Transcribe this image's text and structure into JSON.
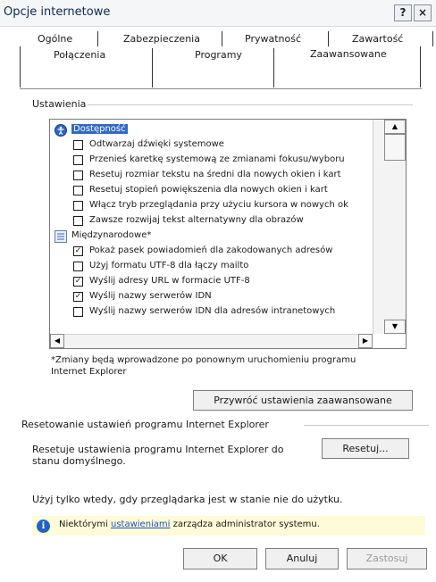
{
  "window": {
    "title": "Opcje internetowe",
    "help_glyph": "?",
    "close_glyph": "×"
  },
  "tabs": {
    "row1": [
      "Ogólne",
      "Zabezpieczenia",
      "Prywatność",
      "Zawartość"
    ],
    "row2": [
      "Połączenia",
      "Programy",
      "Zaawansowane"
    ],
    "active": "Zaawansowane"
  },
  "settings": {
    "group_label": "Ustawienia",
    "items": [
      {
        "type": "category",
        "icon": "accessibility-icon",
        "label": "Dostępność",
        "selected": true
      },
      {
        "type": "checkbox",
        "checked": false,
        "label": "Odtwarzaj dźwięki systemowe"
      },
      {
        "type": "checkbox",
        "checked": false,
        "label": "Przenieś karetkę systemową ze zmianami fokusu/wyboru"
      },
      {
        "type": "checkbox",
        "checked": false,
        "label": "Resetuj rozmiar tekstu na średni dla nowych okien i kart"
      },
      {
        "type": "checkbox",
        "checked": false,
        "label": "Resetuj stopień powiększenia dla nowych okien i kart"
      },
      {
        "type": "checkbox",
        "checked": false,
        "label": "Włącz tryb przeglądania przy użyciu kursora w nowych ok"
      },
      {
        "type": "checkbox",
        "checked": false,
        "label": "Zawsze rozwijaj tekst alternatywny dla obrazów"
      },
      {
        "type": "category",
        "icon": "international-icon",
        "label": "Międzynarodowe*",
        "selected": false
      },
      {
        "type": "checkbox",
        "checked": true,
        "label": "Pokaż pasek powiadomień dla zakodowanych adresów"
      },
      {
        "type": "checkbox",
        "checked": false,
        "label": "Użyj formatu UTF-8 dla łączy mailto"
      },
      {
        "type": "checkbox",
        "checked": true,
        "label": "Wyślij adresy URL w formacie UTF-8"
      },
      {
        "type": "checkbox",
        "checked": true,
        "label": "Wyślij nazwy serwerów IDN"
      },
      {
        "type": "checkbox",
        "checked": false,
        "label": "Wyślij nazwy serwerów IDN dla adresów intranetowych"
      }
    ],
    "note_line1": "*Zmiany będą wprowadzone po ponownym uruchomieniu programu",
    "note_line2": "Internet Explorer",
    "restore_button": "Przywróć ustawienia zaawansowane"
  },
  "reset": {
    "group_label": "Resetowanie ustawień programu Internet Explorer",
    "desc_line1": "Resetuje ustawienia programu Internet Explorer do",
    "desc_line2": "stanu domyślnego.",
    "reset_button": "Resetuj...",
    "warning": "Użyj tylko wtedy, gdy przeglądarka jest w stanie nie do użytku."
  },
  "info": {
    "icon": "info-icon",
    "text_before": "Niektórymi",
    "link": "ustawieniami",
    "text_after": "zarządza administrator systemu."
  },
  "footer": {
    "ok": "OK",
    "cancel": "Anuluj",
    "apply": "Zastosuj"
  },
  "colors": {
    "selection": "#3169c6",
    "info_bar": "#fdfbd8",
    "link": "#1f4fbf"
  }
}
